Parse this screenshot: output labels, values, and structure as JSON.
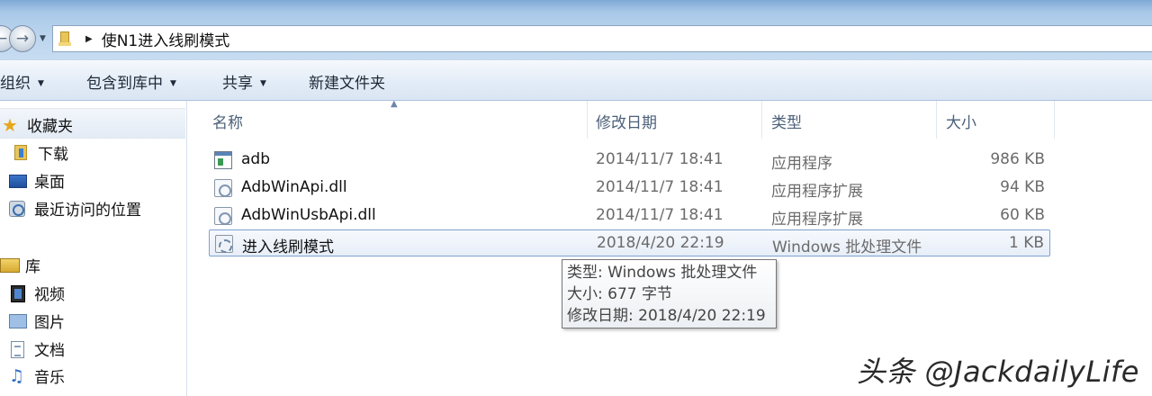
{
  "address_bar": {
    "path": "使N1进入线刷模式"
  },
  "toolbar": {
    "organize_label": "组织",
    "include_in_library_label": "包含到库中",
    "share_label": "共享",
    "new_folder_label": "新建文件夹"
  },
  "nav_pane": {
    "favorites": {
      "label": "收藏夹",
      "items": [
        {
          "label": "下载",
          "icon": "downloads-folder-icon"
        },
        {
          "label": "桌面",
          "icon": "desktop-icon"
        },
        {
          "label": "最近访问的位置",
          "icon": "recent-places-icon"
        }
      ]
    },
    "libraries": {
      "label": "库",
      "items": [
        {
          "label": "视频",
          "icon": "videos-library-icon"
        },
        {
          "label": "图片",
          "icon": "pictures-library-icon"
        },
        {
          "label": "文档",
          "icon": "documents-library-icon"
        },
        {
          "label": "音乐",
          "icon": "music-library-icon"
        }
      ]
    }
  },
  "columns": {
    "name": "名称",
    "date_modified": "修改日期",
    "type": "类型",
    "size": "大小"
  },
  "files": [
    {
      "name": "adb",
      "date": "2014/11/7 18:41",
      "type": "应用程序",
      "size": "986 KB",
      "icon": "application-icon"
    },
    {
      "name": "AdbWinApi.dll",
      "date": "2014/11/7 18:41",
      "type": "应用程序扩展",
      "size": "94 KB",
      "icon": "dll-file-icon"
    },
    {
      "name": "AdbWinUsbApi.dll",
      "date": "2014/11/7 18:41",
      "type": "应用程序扩展",
      "size": "60 KB",
      "icon": "dll-file-icon"
    },
    {
      "name": "进入线刷模式",
      "date": "2018/4/20 22:19",
      "type": "Windows 批处理文件",
      "size": "1 KB",
      "icon": "batch-file-icon",
      "selected": true
    }
  ],
  "tooltip": {
    "type_line": "类型: Windows 批处理文件",
    "size_line": "大小: 677 字节",
    "date_line": "修改日期: 2018/4/20 22:19"
  },
  "watermark": "头条 @JackdailyLife"
}
